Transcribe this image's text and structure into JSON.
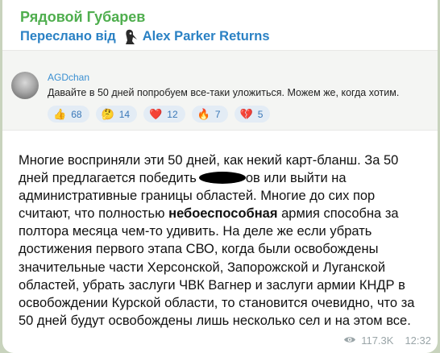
{
  "message": {
    "sender_name": "Рядовой Губарев",
    "forwarded_prefix": "Переслано від",
    "forwarded_from": "Alex Parker Returns",
    "forwarded_avatar_icon": "plague-doctor-icon",
    "quote": {
      "author": "AGDchan",
      "text": "Давайте в 50 дней попробуем все-таки уложиться. Можем же, когда хотим.",
      "reactions": [
        {
          "emoji": "👍",
          "icon": "thumbs-up-icon",
          "count": "68"
        },
        {
          "emoji": "🤔",
          "icon": "thinking-face-icon",
          "count": "14"
        },
        {
          "emoji": "❤️",
          "icon": "red-heart-icon",
          "count": "12"
        },
        {
          "emoji": "🔥",
          "icon": "fire-icon",
          "count": "7"
        },
        {
          "emoji": "💔",
          "icon": "broken-heart-icon",
          "count": "5"
        }
      ]
    },
    "body": {
      "p1": "Многие восприняли эти 50 дней, как некий карт-бланш. За 50 дней предлагается победить",
      "p2": "ов или выйти на административные границы областей. Многие до сих пор считают, что полностью",
      "bold": "небоеспособная",
      "p3": "армия способна за полтора месяца чем-то удивить. На деле же если убрать достижения первого этапа СВО, когда были освобождены значительные части Херсонской, Запорожской и Луганской областей, убрать заслуги ЧВК Вагнер и заслуги армии КНДР в освобождении Курской области, то становится очевидно, что за 50 дней будут освобождены лишь несколько сел и на этом все."
    },
    "views": "117.3K",
    "time": "12:32",
    "colors": {
      "sender": "#4fae4e",
      "forwarded": "#2a81c4",
      "chat_background": "#c8d3bd",
      "reaction_background": "#e3ecf5"
    }
  }
}
